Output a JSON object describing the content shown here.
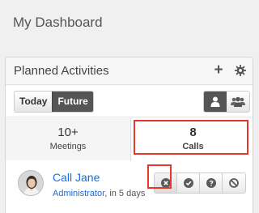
{
  "page": {
    "title": "My Dashboard"
  },
  "dashlet": {
    "title": "Planned Activities",
    "header_icons": [
      "plus-icon",
      "gear-icon"
    ],
    "filters": [
      {
        "label": "Today",
        "active": false
      },
      {
        "label": "Future",
        "active": true
      }
    ],
    "view_toggles": [
      {
        "icon": "user-icon",
        "active": true
      },
      {
        "icon": "users-icon",
        "active": false
      }
    ],
    "tabs": [
      {
        "count": "10+",
        "label": "Meetings",
        "active": false
      },
      {
        "count": "8",
        "label": "Calls",
        "active": true
      }
    ],
    "records": [
      {
        "name": "Call Jane",
        "assigned": "Administrator",
        "due": ", in 5 days",
        "actions": [
          "close-circle-icon",
          "check-circle-icon",
          "question-circle-icon",
          "ban-icon"
        ]
      }
    ]
  },
  "colors": {
    "link": "#176de5",
    "highlight": "#e5372b",
    "active_button": "#555555"
  }
}
